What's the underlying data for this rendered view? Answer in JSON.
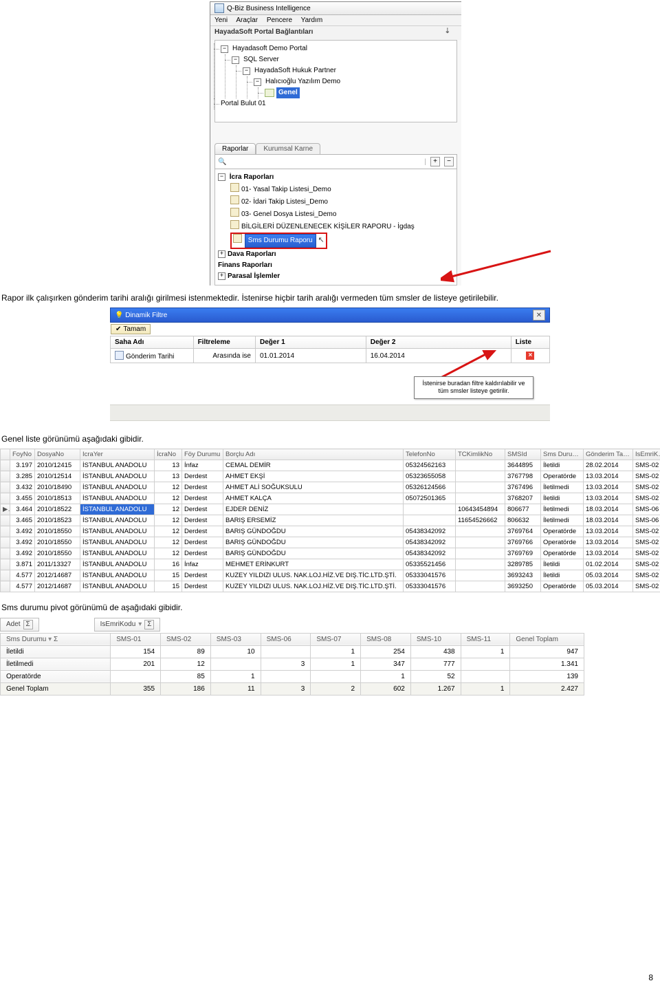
{
  "app": {
    "title": "Q-Biz Business Intelligence",
    "menu": [
      "Yeni",
      "Araçlar",
      "Pencere",
      "Yardım"
    ],
    "panel_title": "HayadaSoft Portal Bağlantıları",
    "portal_tree": {
      "root": "Hayadasoft Demo Portal",
      "n1": "SQL Server",
      "n2": "HayadaSoft Hukuk Partner",
      "n3": "Halıcıoğlu Yazılım Demo",
      "leaf": "Genel",
      "sibling": "Portal Bulut 01"
    },
    "tabs": [
      "Raporlar",
      "Kurumsal Karne"
    ],
    "report_tree": {
      "g0": "İcra Raporları",
      "i0": "01- Yasal Takip Listesi_Demo",
      "i1": "02- İdari Takip Listesi_Demo",
      "i2": "03- Genel Dosya Listesi_Demo",
      "i3": "BİLGİLERİ DÜZENLENECEK KİŞİLER RAPORU - İgdaş",
      "i4": "Sms Durumu Raporu",
      "g1": "Dava Raporları",
      "g2": "Finans Raporları",
      "g3": "Parasal İşlemler"
    }
  },
  "narr": {
    "p1": "Rapor ilk çalışırken gönderim tarihi aralığı girilmesi istenmektedir. İstenirse hiçbir tarih aralığı vermeden tüm smsler de listeye getirilebilir.",
    "p2": "Genel liste görünümü aşağıdaki gibidir.",
    "p3": "Sms durumu pivot görünümü de aşağıdaki gibidir."
  },
  "filter": {
    "dlg_title": "Dinamik Filtre",
    "ok": "Tamam",
    "cols": [
      "Saha Adı",
      "Filtreleme",
      "Değer 1",
      "Değer 2",
      "Liste"
    ],
    "row": {
      "field": "Gönderim Tarihi",
      "op": "Arasında ise",
      "v1": "01.01.2014",
      "v2": "16.04.2014"
    },
    "hint": "İstenirse buradan filtre kaldırılabilir ve tüm smsler listeye getirilir."
  },
  "grid_cols": [
    "FoyNo",
    "DosyaNo",
    "IcraYer",
    "İcraNo",
    "Föy Durumu",
    "Borçlu Adı",
    "TelefonNo",
    "TCKimlikNo",
    "SMSId",
    "Sms Durumu",
    "Gönderim Tarihi",
    "IsEmriKodu"
  ],
  "grid_rows": [
    {
      "foy": "3.197",
      "dosya": "2010/12415",
      "icrayer": "İSTANBUL ANADOLU",
      "icrano": "13",
      "durum": "İnfaz",
      "borclu": "CEMAL DEMİR",
      "tel": "05324562163",
      "tck": "",
      "sms": "3644895",
      "smsd": "İletildi",
      "tar": "28.02.2014",
      "emr": "SMS-02"
    },
    {
      "foy": "3.285",
      "dosya": "2010/12514",
      "icrayer": "İSTANBUL ANADOLU",
      "icrano": "13",
      "durum": "Derdest",
      "borclu": "AHMET EKŞİ",
      "tel": "05323655058",
      "tck": "",
      "sms": "3767798",
      "smsd": "Operatörde",
      "tar": "13.03.2014",
      "emr": "SMS-02"
    },
    {
      "foy": "3.432",
      "dosya": "2010/18490",
      "icrayer": "İSTANBUL ANADOLU",
      "icrano": "12",
      "durum": "Derdest",
      "borclu": "AHMET ALİ SOĞUKSULU",
      "tel": "05326124566",
      "tck": "",
      "sms": "3767496",
      "smsd": "İletilmedi",
      "tar": "13.03.2014",
      "emr": "SMS-02"
    },
    {
      "foy": "3.455",
      "dosya": "2010/18513",
      "icrayer": "İSTANBUL ANADOLU",
      "icrano": "12",
      "durum": "Derdest",
      "borclu": "AHMET KALÇA",
      "tel": "05072501365",
      "tck": "",
      "sms": "3768207",
      "smsd": "İletildi",
      "tar": "13.03.2014",
      "emr": "SMS-02"
    },
    {
      "foy": "3.464",
      "dosya": "2010/18522",
      "icrayer": "İSTANBUL ANADOLU",
      "icrano": "12",
      "durum": "Derdest",
      "borclu": "EJDER DENİZ",
      "tel": "",
      "tck": "10643454894",
      "sms": "806677",
      "smsd": "İletilmedi",
      "tar": "18.03.2014",
      "emr": "SMS-06",
      "sel": true,
      "mark": true
    },
    {
      "foy": "3.465",
      "dosya": "2010/18523",
      "icrayer": "İSTANBUL ANADOLU",
      "icrano": "12",
      "durum": "Derdest",
      "borclu": "BARIŞ ERSEMİZ",
      "tel": "",
      "tck": "11654526662",
      "sms": "806632",
      "smsd": "İletilmedi",
      "tar": "18.03.2014",
      "emr": "SMS-06"
    },
    {
      "foy": "3.492",
      "dosya": "2010/18550",
      "icrayer": "İSTANBUL ANADOLU",
      "icrano": "12",
      "durum": "Derdest",
      "borclu": "BARIŞ GÜNDOĞDU",
      "tel": "05438342092",
      "tck": "",
      "sms": "3769764",
      "smsd": "Operatörde",
      "tar": "13.03.2014",
      "emr": "SMS-02"
    },
    {
      "foy": "3.492",
      "dosya": "2010/18550",
      "icrayer": "İSTANBUL ANADOLU",
      "icrano": "12",
      "durum": "Derdest",
      "borclu": "BARIŞ GÜNDOĞDU",
      "tel": "05438342092",
      "tck": "",
      "sms": "3769766",
      "smsd": "Operatörde",
      "tar": "13.03.2014",
      "emr": "SMS-02"
    },
    {
      "foy": "3.492",
      "dosya": "2010/18550",
      "icrayer": "İSTANBUL ANADOLU",
      "icrano": "12",
      "durum": "Derdest",
      "borclu": "BARIŞ GÜNDOĞDU",
      "tel": "05438342092",
      "tck": "",
      "sms": "3769769",
      "smsd": "Operatörde",
      "tar": "13.03.2014",
      "emr": "SMS-02"
    },
    {
      "foy": "3.871",
      "dosya": "2011/13327",
      "icrayer": "İSTANBUL ANADOLU",
      "icrano": "16",
      "durum": "İnfaz",
      "borclu": "MEHMET ERİNKURT",
      "tel": "05335521456",
      "tck": "",
      "sms": "3289785",
      "smsd": "İletildi",
      "tar": "01.02.2014",
      "emr": "SMS-02"
    },
    {
      "foy": "4.577",
      "dosya": "2012/14687",
      "icrayer": "İSTANBUL ANADOLU",
      "icrano": "15",
      "durum": "Derdest",
      "borclu": "KUZEY YILDIZI ULUS. NAK.LOJ.HİZ.VE DIŞ.TİC.LTD.ŞTİ.",
      "tel": "05333041576",
      "tck": "",
      "sms": "3693243",
      "smsd": "İletildi",
      "tar": "05.03.2014",
      "emr": "SMS-02"
    },
    {
      "foy": "4.577",
      "dosya": "2012/14687",
      "icrayer": "İSTANBUL ANADOLU",
      "icrano": "15",
      "durum": "Derdest",
      "borclu": "KUZEY YILDIZI ULUS. NAK.LOJ.HİZ.VE DIŞ.TİC.LTD.ŞTİ.",
      "tel": "05333041576",
      "tck": "",
      "sms": "3693250",
      "smsd": "Operatörde",
      "tar": "05.03.2014",
      "emr": "SMS-02"
    }
  ],
  "pivot": {
    "adet": "Adet",
    "isemri": "IsEmriKodu",
    "rowfield": "Sms Durumu",
    "cols": [
      "SMS-01",
      "SMS-02",
      "SMS-03",
      "SMS-06",
      "SMS-07",
      "SMS-08",
      "SMS-10",
      "SMS-11",
      "Genel Toplam"
    ],
    "rows": [
      {
        "label": "İletildi",
        "v": [
          "154",
          "89",
          "10",
          "",
          "1",
          "254",
          "438",
          "1",
          "947"
        ]
      },
      {
        "label": "İletilmedi",
        "v": [
          "201",
          "12",
          "",
          "3",
          "1",
          "347",
          "777",
          "",
          "1.341"
        ]
      },
      {
        "label": "Operatörde",
        "v": [
          "",
          "85",
          "1",
          "",
          "",
          "1",
          "52",
          "",
          "139"
        ]
      },
      {
        "label": "Genel Toplam",
        "v": [
          "355",
          "186",
          "11",
          "3",
          "2",
          "602",
          "1.267",
          "1",
          "2.427"
        ],
        "total": true
      }
    ]
  },
  "page_num": "8"
}
